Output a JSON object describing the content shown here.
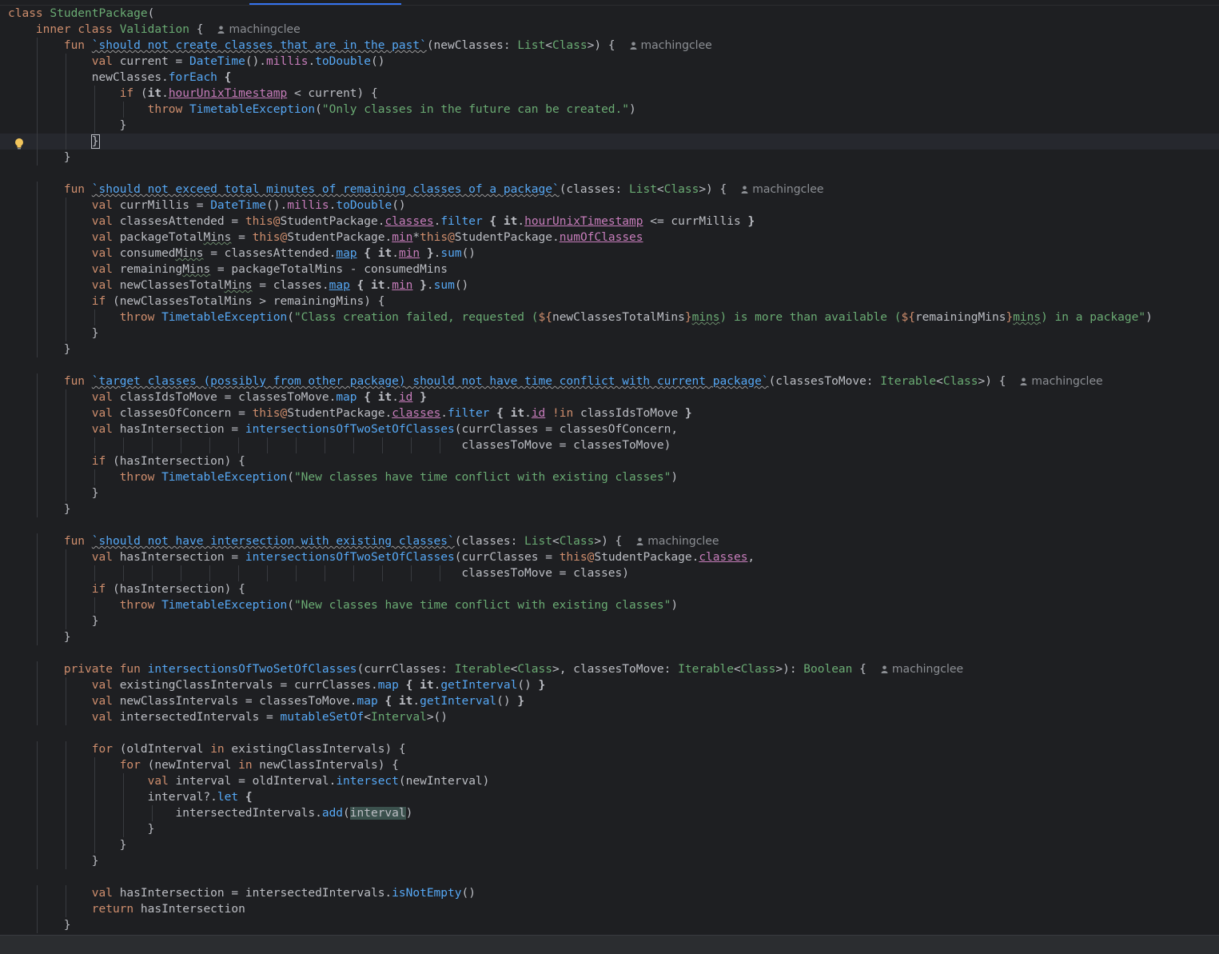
{
  "editor": {
    "language": "Kotlin",
    "author": "machingclee",
    "lines": [
      "class StudentPackage(",
      "    inner class Validation {",
      "        fun `should not create classes that are in the past`(newClasses: List<Class>) {",
      "            val current = DateTime().millis.toDouble()",
      "            newClasses.forEach {",
      "                if (it.hourUnixTimestamp < current) {",
      "                    throw TimetableException(\"Only classes in the future can be created.\")",
      "                }",
      "            }",
      "        }",
      "",
      "        fun `should not exceed total minutes of remaining classes of a package`(classes: List<Class>) {",
      "            val currMillis = DateTime().millis.toDouble()",
      "            val classesAttended = this@StudentPackage.classes.filter { it.hourUnixTimestamp <= currMillis }",
      "            val packageTotalMins = this@StudentPackage.min*this@StudentPackage.numOfClasses",
      "            val consumedMins = classesAttended.map { it.min }.sum()",
      "            val remainingMins = packageTotalMins - consumedMins",
      "            val newClassesTotalMins = classes.map { it.min }.sum()",
      "            if (newClassesTotalMins > remainingMins) {",
      "                throw TimetableException(\"Class creation failed, requested (${newClassesTotalMins}mins) is more than available (${remainingMins}mins) in a package\")",
      "            }",
      "        }",
      "",
      "        fun `target classes (possibly from other package) should not have time conflict with current package`(classesToMove: Iterable<Class>) {",
      "            val classIdsToMove = classesToMove.map { it.id }",
      "            val classesOfConcern = this@StudentPackage.classes.filter { it.id !in classIdsToMove }",
      "            val hasIntersection = intersectionsOfTwoSetOfClasses(currClasses = classesOfConcern,",
      "                                                                 classesToMove = classesToMove)",
      "            if (hasIntersection) {",
      "                throw TimetableException(\"New classes have time conflict with existing classes\")",
      "            }",
      "        }",
      "",
      "        fun `should not have intersection with existing classes`(classes: List<Class>) {",
      "            val hasIntersection = intersectionsOfTwoSetOfClasses(currClasses = this@StudentPackage.classes,",
      "                                                                 classesToMove = classes)",
      "            if (hasIntersection) {",
      "                throw TimetableException(\"New classes have time conflict with existing classes\")",
      "            }",
      "        }",
      "",
      "        private fun intersectionsOfTwoSetOfClasses(currClasses: Iterable<Class>, classesToMove: Iterable<Class>): Boolean {",
      "            val existingClassIntervals = currClasses.map { it.getInterval() }",
      "            val newClassIntervals = classesToMove.map { it.getInterval() }",
      "            val intersectedIntervals = mutableSetOf<Interval>()",
      "",
      "            for (oldInterval in existingClassIntervals) {",
      "                for (newInterval in newClassIntervals) {",
      "                    val interval = oldInterval.intersect(newInterval)",
      "                    interval?.let {",
      "                        intersectedIntervals.add(interval)",
      "                    }",
      "                }",
      "            }",
      "",
      "            val hasIntersection = intersectedIntervals.isNotEmpty()",
      "            return hasIntersection",
      "        }"
    ],
    "author_lines": [
      1,
      2,
      11,
      23,
      33,
      41
    ],
    "current_line": 8
  },
  "colors": {
    "background": "#1e1f22",
    "keyword": "#cf8e6d",
    "string": "#6aab73",
    "function": "#56a8f5",
    "property": "#c77dbb",
    "text": "#bcbec4",
    "author_hint": "#8c8f94"
  },
  "icons": {
    "gutter": "lightbulb-icon",
    "author": "user-icon"
  }
}
